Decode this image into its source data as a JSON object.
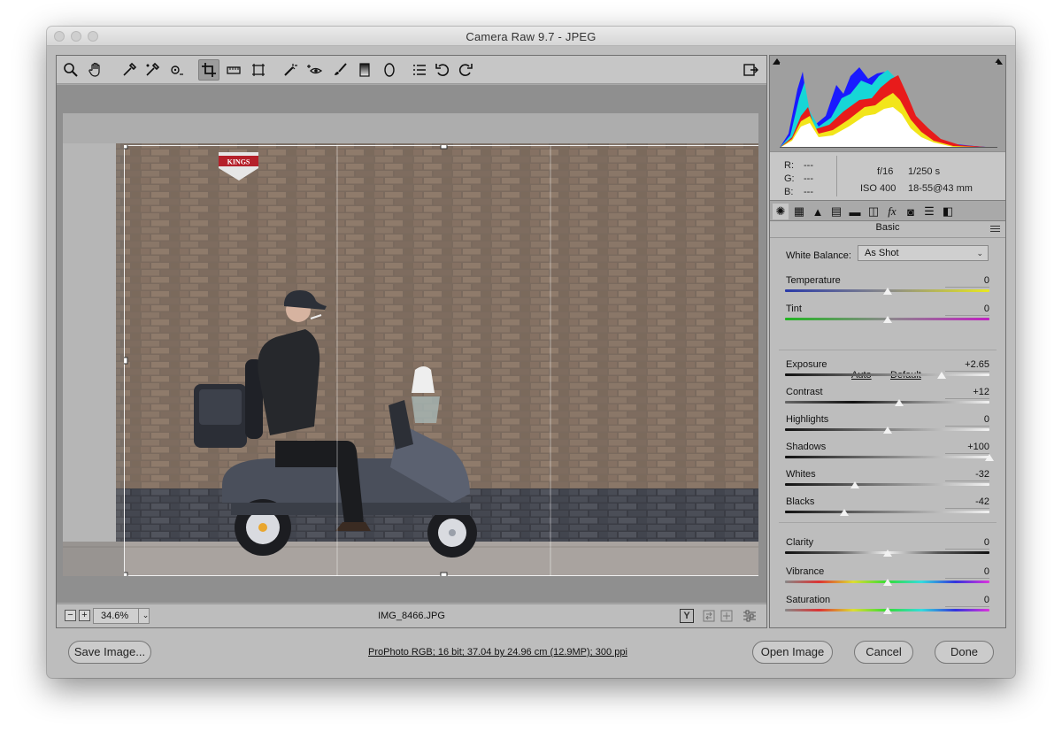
{
  "window": {
    "title": "Camera Raw 9.7  -  JPEG"
  },
  "toolbar": {
    "tools": [
      "zoom-icon",
      "hand-icon",
      "white-balance-icon",
      "color-sampler-icon",
      "targeted-adjustment-icon",
      "crop-icon",
      "straighten-icon",
      "transform-icon",
      "spot-removal-icon",
      "red-eye-icon",
      "adjustment-brush-icon",
      "graduated-filter-icon",
      "radial-filter-icon",
      "preferences-icon",
      "rotate-ccw-icon",
      "rotate-cw-icon"
    ],
    "active_tool": "crop-icon"
  },
  "preview": {
    "watermark_sign": "KINGS"
  },
  "status": {
    "zoom": "34.6%",
    "filename": "IMG_8466.JPG",
    "y_label": "Y"
  },
  "histogram": {
    "type": "area"
  },
  "readout": {
    "r_label": "R:",
    "r_value": "---",
    "g_label": "G:",
    "g_value": "---",
    "b_label": "B:",
    "b_value": "---",
    "aperture": "f/16",
    "shutter": "1/250 s",
    "iso": "ISO 400",
    "lens": "18-55@43 mm"
  },
  "panel": {
    "title": "Basic",
    "tabs": [
      "basic-icon",
      "tone-curve-icon",
      "detail-icon",
      "hsl-icon",
      "split-toning-icon",
      "lens-corrections-icon",
      "effects-icon",
      "camera-calibration-icon",
      "presets-icon",
      "snapshots-icon"
    ],
    "white_balance": {
      "label": "White Balance:",
      "value": "As Shot"
    },
    "auto_label": "Auto",
    "default_label": "Default",
    "sliders": [
      {
        "label": "Temperature",
        "value": "0",
        "position": 0.5
      },
      {
        "label": "Tint",
        "value": "0",
        "position": 0.5
      },
      {
        "label": "Exposure",
        "value": "+2.65",
        "position": 0.765
      },
      {
        "label": "Contrast",
        "value": "+12",
        "position": 0.56
      },
      {
        "label": "Highlights",
        "value": "0",
        "position": 0.5
      },
      {
        "label": "Shadows",
        "value": "+100",
        "position": 1.0
      },
      {
        "label": "Whites",
        "value": "-32",
        "position": 0.34
      },
      {
        "label": "Blacks",
        "value": "-42",
        "position": 0.29
      },
      {
        "label": "Clarity",
        "value": "0",
        "position": 0.5
      },
      {
        "label": "Vibrance",
        "value": "0",
        "position": 0.5
      },
      {
        "label": "Saturation",
        "value": "0",
        "position": 0.5
      }
    ]
  },
  "footer": {
    "save_label": "Save Image...",
    "info": "ProPhoto RGB; 16 bit; 37.04 by 24.96 cm (12.9MP); 300 ppi",
    "open_label": "Open Image",
    "cancel_label": "Cancel",
    "done_label": "Done"
  }
}
